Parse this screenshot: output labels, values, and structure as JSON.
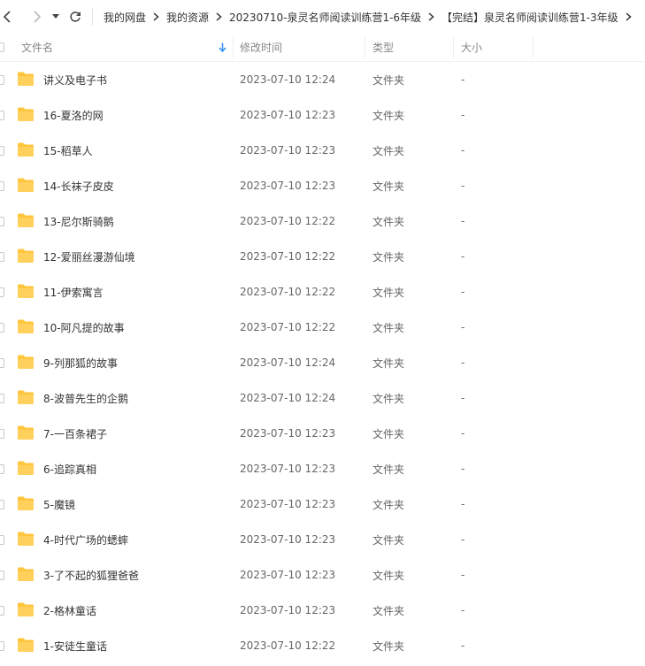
{
  "breadcrumb": {
    "items": [
      "我的网盘",
      "我的资源",
      "20230710-泉灵名师阅读训练营1-6年级",
      "【完结】泉灵名师阅读训练营1-3年级"
    ]
  },
  "header": {
    "name": "文件名",
    "modified": "修改时间",
    "type": "类型",
    "size": "大小"
  },
  "files": [
    {
      "name": "讲义及电子书",
      "date": "2023-07-10 12:24",
      "type": "文件夹",
      "size": "-"
    },
    {
      "name": "16-夏洛的网",
      "date": "2023-07-10 12:23",
      "type": "文件夹",
      "size": "-"
    },
    {
      "name": "15-稻草人",
      "date": "2023-07-10 12:23",
      "type": "文件夹",
      "size": "-"
    },
    {
      "name": "14-长袜子皮皮",
      "date": "2023-07-10 12:23",
      "type": "文件夹",
      "size": "-"
    },
    {
      "name": "13-尼尔斯骑鹅",
      "date": "2023-07-10 12:22",
      "type": "文件夹",
      "size": "-"
    },
    {
      "name": "12-爱丽丝漫游仙境",
      "date": "2023-07-10 12:22",
      "type": "文件夹",
      "size": "-"
    },
    {
      "name": "11-伊索寓言",
      "date": "2023-07-10 12:22",
      "type": "文件夹",
      "size": "-"
    },
    {
      "name": "10-阿凡提的故事",
      "date": "2023-07-10 12:22",
      "type": "文件夹",
      "size": "-"
    },
    {
      "name": "9-列那狐的故事",
      "date": "2023-07-10 12:24",
      "type": "文件夹",
      "size": "-"
    },
    {
      "name": "8-波普先生的企鹅",
      "date": "2023-07-10 12:24",
      "type": "文件夹",
      "size": "-"
    },
    {
      "name": "7-一百条裙子",
      "date": "2023-07-10 12:23",
      "type": "文件夹",
      "size": "-"
    },
    {
      "name": "6-追踪真相",
      "date": "2023-07-10 12:23",
      "type": "文件夹",
      "size": "-"
    },
    {
      "name": "5-魔镜",
      "date": "2023-07-10 12:23",
      "type": "文件夹",
      "size": "-"
    },
    {
      "name": "4-时代广场的蟋蟀",
      "date": "2023-07-10 12:23",
      "type": "文件夹",
      "size": "-"
    },
    {
      "name": "3-了不起的狐狸爸爸",
      "date": "2023-07-10 12:23",
      "type": "文件夹",
      "size": "-"
    },
    {
      "name": "2-格林童话",
      "date": "2023-07-10 12:23",
      "type": "文件夹",
      "size": "-"
    },
    {
      "name": "1-安徒生童话",
      "date": "2023-07-10 12:22",
      "type": "文件夹",
      "size": "-"
    }
  ],
  "colors": {
    "folder": "#FFC53D",
    "sort_arrow": "#2f8cf5"
  }
}
